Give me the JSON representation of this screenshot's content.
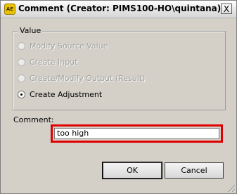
{
  "window": {
    "title": "Comment (Creator: PIMS100-HO\\quintana)",
    "app_icon_text": "AE",
    "close_glyph": "X"
  },
  "group": {
    "label": "Value",
    "options": [
      {
        "label": "Modify Source Value",
        "enabled": false,
        "selected": false
      },
      {
        "label": "Create Input",
        "enabled": false,
        "selected": false
      },
      {
        "label": "Create/Modify Output (Result)",
        "enabled": false,
        "selected": false
      },
      {
        "label": "Create Adjustment",
        "enabled": true,
        "selected": true
      }
    ]
  },
  "comment": {
    "label": "Comment:",
    "value": "too high"
  },
  "buttons": {
    "ok": "OK",
    "cancel": "Cancel"
  },
  "colors": {
    "highlight": "#e00000",
    "dialog_bg": "#d4d0c8"
  }
}
